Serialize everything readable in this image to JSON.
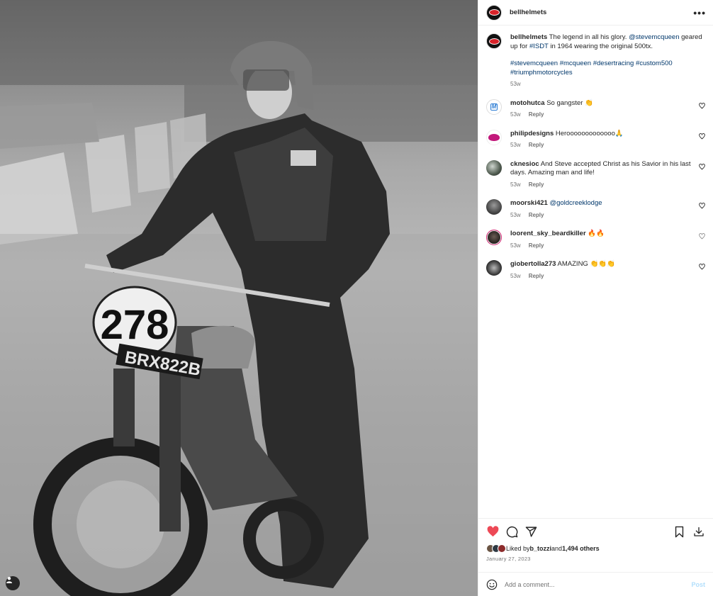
{
  "media": {
    "alt_tag_icon": "user-tag-icon"
  },
  "header": {
    "username": "bellhelmets",
    "more_label": "•••"
  },
  "caption": {
    "username": "bellhelmets",
    "text_1": " The legend in all his glory. ",
    "mention": "@stevemcqueen",
    "text_2": " geared up for ",
    "hashtag_isdt": "#ISDT",
    "text_3": " in 1964 wearing the original 500tx.",
    "tags": [
      "#stevemcqueen",
      "#mcqueen",
      "#desertracing",
      "#custom500",
      "#triumphmotorcycles"
    ],
    "age": "53w"
  },
  "comments": [
    {
      "username": "motohutca",
      "text": " So gangster 👏",
      "age": "53w",
      "reply": "Reply"
    },
    {
      "username": "philipdesigns",
      "text": " Herooooooooooooo🙏",
      "age": "53w",
      "reply": "Reply"
    },
    {
      "username": "cknesioc",
      "text": " And Steve accepted Christ as his Savior in his last days. Amazing man and life!",
      "age": "53w",
      "reply": "Reply"
    },
    {
      "username": "moorski421",
      "text": " ",
      "mention": "@goldcreeklodge",
      "age": "53w",
      "reply": "Reply"
    },
    {
      "username": "loorent_sky_beardkiller",
      "text": " 🔥🔥",
      "age": "53w",
      "reply": "Reply"
    },
    {
      "username": "giobertolla273",
      "text": " AMAZING 👏👏👏",
      "age": "53w",
      "reply": "Reply"
    }
  ],
  "likes": {
    "prefix": "Liked by ",
    "user": "b_tozzi",
    "middle": " and ",
    "count": "1,494 others"
  },
  "date": "January 27, 2023",
  "add_comment": {
    "placeholder": "Add a comment...",
    "post_label": "Post"
  },
  "colors": {
    "like_red": "#ed4956",
    "link": "#00376b",
    "post_btn": "#b2dffc"
  },
  "icons": [
    "heart-filled-icon",
    "comment-icon",
    "share-icon",
    "bookmark-icon",
    "download-icon",
    "emoji-icon",
    "heart-outline-icon"
  ]
}
